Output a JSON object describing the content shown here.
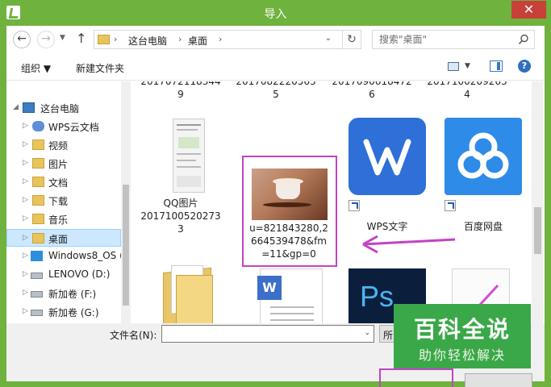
{
  "window": {
    "title": "导入",
    "close_glyph": "✕"
  },
  "address": {
    "back": "←",
    "forward": "→",
    "recent": "▼",
    "up": "↑",
    "crumbs": [
      "这台电脑",
      "桌面"
    ],
    "crumb_sep": "›",
    "dropdown": "⌄",
    "refresh": "↻"
  },
  "search": {
    "placeholder": "搜索\"桌面\""
  },
  "toolbar": {
    "organize": "组织 ▼",
    "new_folder": "新建文件夹",
    "view_dd": "▼",
    "help": "?"
  },
  "nav": {
    "items": [
      {
        "label": "这台电脑",
        "arrow": "◢",
        "icon": "computer-icon"
      },
      {
        "label": "WPS云文档",
        "arrow": "▷",
        "icon": "cloud-icon"
      },
      {
        "label": "视频",
        "arrow": "▷",
        "icon": "folder-icon"
      },
      {
        "label": "图片",
        "arrow": "▷",
        "icon": "folder-icon"
      },
      {
        "label": "文档",
        "arrow": "▷",
        "icon": "folder-icon"
      },
      {
        "label": "下载",
        "arrow": "▷",
        "icon": "folder-icon"
      },
      {
        "label": "音乐",
        "arrow": "▷",
        "icon": "folder-icon"
      },
      {
        "label": "桌面",
        "arrow": "▷",
        "icon": "folder-icon",
        "selected": true
      },
      {
        "label": "Windows8_OS (",
        "arrow": "▷",
        "icon": "drive-icon"
      },
      {
        "label": "LENOVO (D:)",
        "arrow": "▷",
        "icon": "drive-icon"
      },
      {
        "label": "新加卷 (F:)",
        "arrow": "▷",
        "icon": "drive-icon"
      },
      {
        "label": "新加卷 (G:)",
        "arrow": "▷",
        "icon": "drive-icon"
      }
    ]
  },
  "files": {
    "top_row": [
      {
        "name_line1": "QQ图片",
        "name_line2": "20170721183449",
        "partial": "2017072118344\n9"
      },
      {
        "partial": "2017082220563\n5"
      },
      {
        "partial": "2017090618472\n6"
      },
      {
        "partial": "2017100209263\n4"
      }
    ],
    "row2": [
      {
        "label": "QQ图片\n2017100520273\n3"
      },
      {
        "label": "u=821843280,2\n664539478&fm\n=11&gp=0"
      },
      {
        "label": "WPS文字"
      },
      {
        "label": "百度网盘"
      }
    ]
  },
  "bottom": {
    "filename_label": "文件名(N):",
    "filename_value": "",
    "type_label": "所",
    "dropdown": "⌄"
  },
  "watermark": {
    "main": "百科全说",
    "sub": "助你轻松解决"
  },
  "colors": {
    "titlebar": "#6fb23e",
    "highlight": "#c442c4",
    "close": "#c7403a"
  }
}
